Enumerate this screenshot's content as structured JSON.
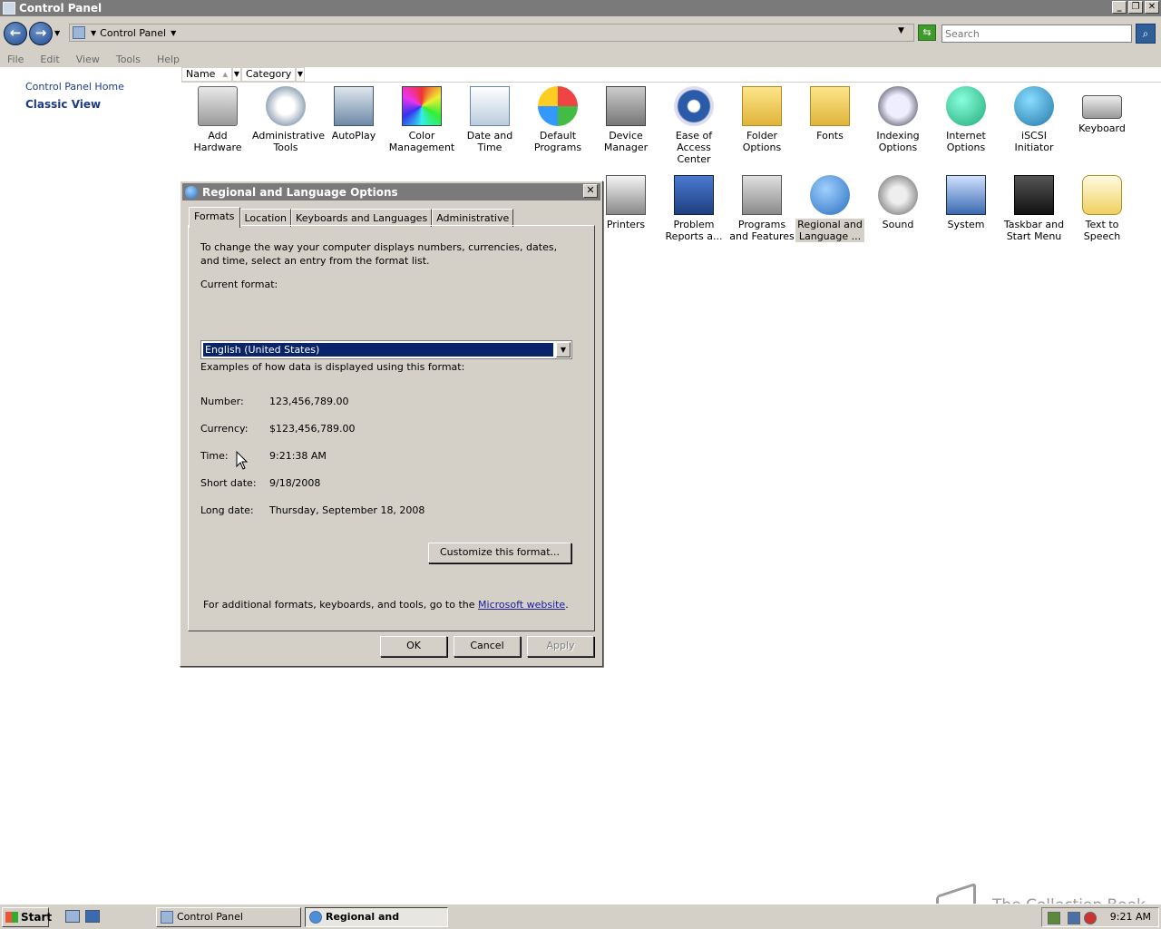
{
  "window": {
    "title": "Control Panel"
  },
  "address": {
    "path_label": "Control Panel",
    "search_placeholder": "Search"
  },
  "menu": [
    "File",
    "Edit",
    "View",
    "Tools",
    "Help"
  ],
  "left_pane": {
    "home_link": "Control Panel Home",
    "classic_view": "Classic View"
  },
  "columns": {
    "name": "Name",
    "category": "Category"
  },
  "icons_row1": [
    {
      "label": "Add Hardware",
      "icon": "add-hardware-icon"
    },
    {
      "label": "Administrative Tools",
      "icon": "administrative-tools-icon"
    },
    {
      "label": "AutoPlay",
      "icon": "autoplay-icon"
    },
    {
      "label": "Color Management",
      "icon": "color-management-icon"
    },
    {
      "label": "Date and Time",
      "icon": "date-time-icon"
    },
    {
      "label": "Default Programs",
      "icon": "default-programs-icon"
    },
    {
      "label": "Device Manager",
      "icon": "device-manager-icon"
    },
    {
      "label": "Ease of Access Center",
      "icon": "ease-of-access-icon"
    },
    {
      "label": "Folder Options",
      "icon": "folder-options-icon"
    },
    {
      "label": "Fonts",
      "icon": "fonts-icon"
    },
    {
      "label": "Indexing Options",
      "icon": "indexing-options-icon"
    },
    {
      "label": "Internet Options",
      "icon": "internet-options-icon"
    },
    {
      "label": "iSCSI Initiator",
      "icon": "iscsi-initiator-icon"
    },
    {
      "label": "Keyboard",
      "icon": "keyboard-icon"
    }
  ],
  "icons_row2": [
    {
      "label": "Printers",
      "icon": "printers-icon"
    },
    {
      "label": "Problem Reports a...",
      "icon": "problem-reports-icon"
    },
    {
      "label": "Programs and Features",
      "icon": "programs-features-icon"
    },
    {
      "label": "Regional and Language ...",
      "icon": "regional-language-icon",
      "selected": true
    },
    {
      "label": "Sound",
      "icon": "sound-icon"
    },
    {
      "label": "System",
      "icon": "system-icon"
    },
    {
      "label": "Taskbar and Start Menu",
      "icon": "taskbar-start-menu-icon"
    },
    {
      "label": "Text to Speech",
      "icon": "text-to-speech-icon"
    }
  ],
  "dialog": {
    "title": "Regional and Language Options",
    "tabs": [
      "Formats",
      "Location",
      "Keyboards and Languages",
      "Administrative"
    ],
    "intro": "To change the way your computer displays numbers, currencies, dates, and time, select an entry from the format list.",
    "current_format_label": "Current format:",
    "current_format_value": "English (United States)",
    "examples_heading": "Examples of how data is displayed using this format:",
    "examples": [
      {
        "label": "Number:",
        "value": "123,456,789.00"
      },
      {
        "label": "Currency:",
        "value": "$123,456,789.00"
      },
      {
        "label": "Time:",
        "value": "9:21:38 AM"
      },
      {
        "label": "Short date:",
        "value": "9/18/2008"
      },
      {
        "label": "Long date:",
        "value": "Thursday, September 18, 2008"
      }
    ],
    "customize_button": "Customize this format...",
    "footer_text": "For additional formats, keyboards, and tools, go to the ",
    "footer_link": "Microsoft website",
    "footer_end": ".",
    "ok": "OK",
    "cancel": "Cancel",
    "apply": "Apply"
  },
  "taskbar": {
    "start": "Start",
    "tasks": [
      "Control Panel",
      "Regional and Langua..."
    ],
    "clock": "9:21 AM"
  },
  "watermark": "The Collection Book"
}
